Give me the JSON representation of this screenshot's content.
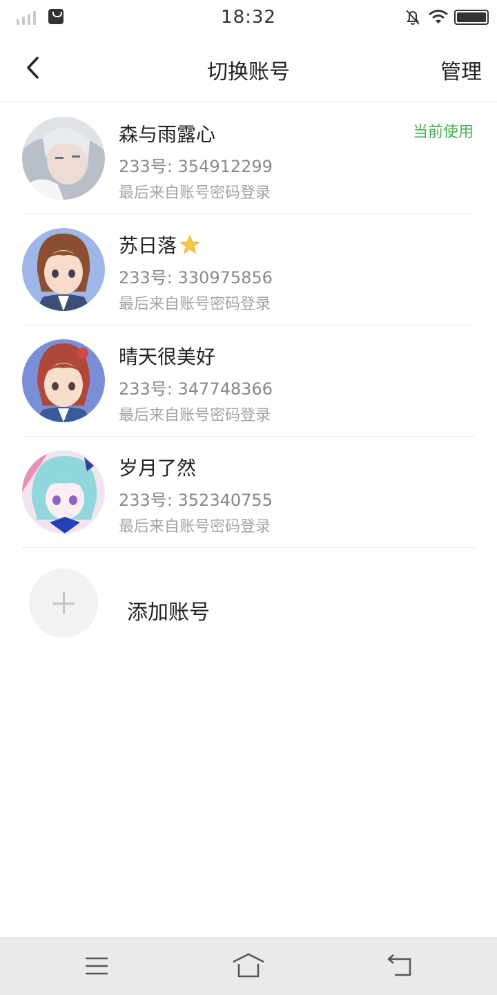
{
  "status_bar": {
    "time": "18:32",
    "icons": [
      "signal-icon",
      "shopping-bag-icon",
      "bell-muted-icon",
      "wifi-icon",
      "battery-icon"
    ]
  },
  "header": {
    "back_icon": "chevron-left-icon",
    "title": "切换账号",
    "manage_label": "管理"
  },
  "accounts": [
    {
      "name": "森与雨露心",
      "id_text": "233号: 354912299",
      "login_text": "最后来自账号密码登录",
      "badge": "当前使用",
      "avatar_icon": "avatar-silver-hair"
    },
    {
      "name": "苏日落",
      "id_text": "233号: 330975856",
      "login_text": "最后来自账号密码登录",
      "badge": "",
      "avatar_icon": "avatar-brown-hair",
      "name_icon": "star-icon"
    },
    {
      "name": "晴天很美好",
      "id_text": "233号: 347748366",
      "login_text": "最后来自账号密码登录",
      "badge": "",
      "avatar_icon": "avatar-red-hair"
    },
    {
      "name": "岁月了然",
      "id_text": "233号: 352340755",
      "login_text": "最后来自账号密码登录",
      "badge": "",
      "avatar_icon": "avatar-teal-hair"
    }
  ],
  "add_account": {
    "label": "添加账号",
    "icon": "plus-icon"
  },
  "system_nav": {
    "icons": [
      "menu-icon",
      "home-icon",
      "back-icon"
    ]
  },
  "colors": {
    "accent_green": "#4caf50",
    "divider": "#ebebeb",
    "secondary_text": "#888888",
    "system_nav_bg": "#eaeaea"
  }
}
